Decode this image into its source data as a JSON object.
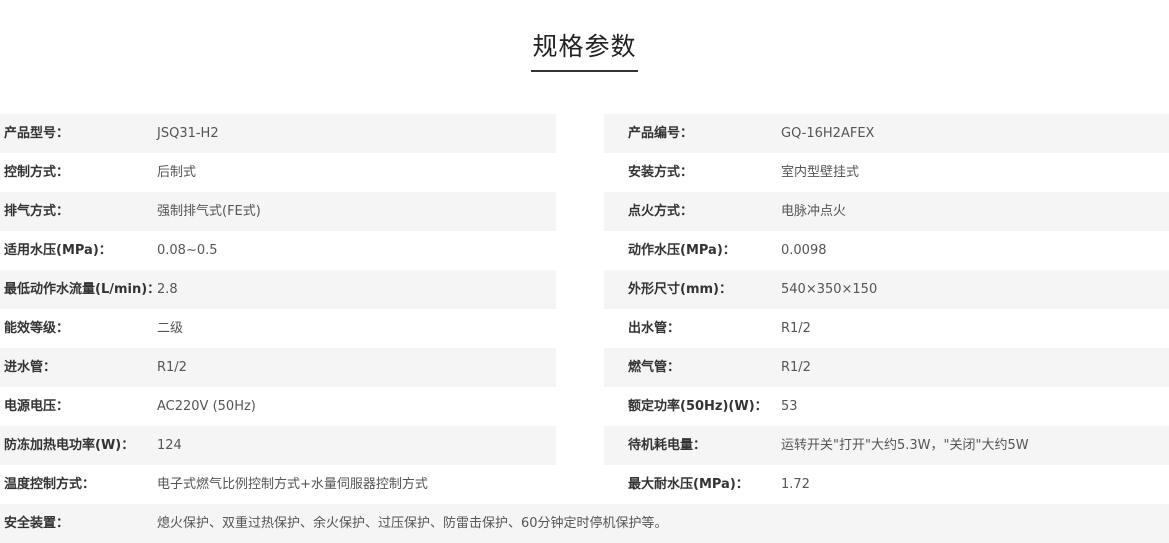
{
  "title": "规格参数",
  "rows": [
    {
      "left": {
        "label": "产品型号：",
        "value": "JSQ31-H2"
      },
      "right": {
        "label": "产品编号：",
        "value": "GQ-16H2AFEX"
      }
    },
    {
      "left": {
        "label": "控制方式：",
        "value": "后制式"
      },
      "right": {
        "label": "安装方式：",
        "value": "室内型壁挂式"
      }
    },
    {
      "left": {
        "label": "排气方式：",
        "value": "强制排气式(FE式)"
      },
      "right": {
        "label": "点火方式：",
        "value": "电脉冲点火"
      }
    },
    {
      "left": {
        "label": "适用水压(MPa)：",
        "value": "0.08~0.5"
      },
      "right": {
        "label": "动作水压(MPa)：",
        "value": "0.0098"
      }
    },
    {
      "left": {
        "label": "最低动作水流量(L/min)：",
        "value": "2.8"
      },
      "right": {
        "label": "外形尺寸(mm)：",
        "value": "540×350×150"
      }
    },
    {
      "left": {
        "label": "能效等级：",
        "value": "二级"
      },
      "right": {
        "label": "出水管：",
        "value": "R1/2"
      }
    },
    {
      "left": {
        "label": "进水管：",
        "value": "R1/2"
      },
      "right": {
        "label": "燃气管：",
        "value": " R1/2"
      }
    },
    {
      "left": {
        "label": "电源电压：",
        "value": "AC220V (50Hz)"
      },
      "right": {
        "label": "额定功率(50Hz)(W)：",
        "value": " 53"
      }
    },
    {
      "left": {
        "label": "防冻加热电功率(W)：",
        "value": "124"
      },
      "right": {
        "label": "待机耗电量：",
        "value": "运转开关\"打开\"大约5.3W，\"关闭\"大约5W"
      }
    },
    {
      "left": {
        "label": "温度控制方式：",
        "value": "电子式燃气比例控制方式+水量伺服器控制方式"
      },
      "right": {
        "label": "最大耐水压(MPa)：",
        "value": "1.72"
      }
    }
  ],
  "full_row": {
    "label": "安全装置：",
    "value": "熄火保护、双重过热保护、余火保护、过压保护、防雷击保护、60分钟定时停机保护等。"
  }
}
